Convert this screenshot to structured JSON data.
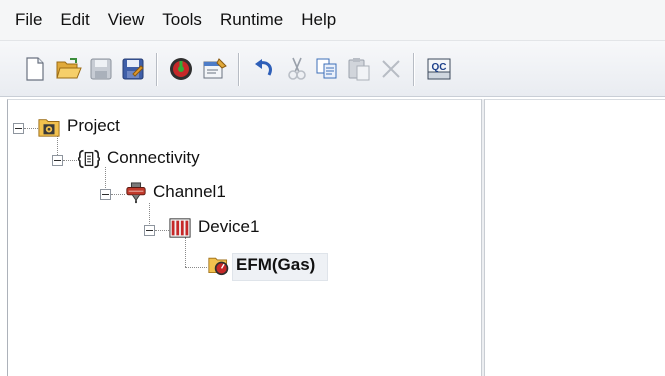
{
  "menu": [
    "File",
    "Edit",
    "View",
    "Tools",
    "Runtime",
    "Help"
  ],
  "toolbar": {
    "buttons": [
      {
        "name": "new-project-icon"
      },
      {
        "name": "open-folder-icon"
      },
      {
        "name": "save-icon"
      },
      {
        "name": "save-as-icon"
      },
      {
        "name": "connect-runtime-icon"
      },
      {
        "name": "properties-icon"
      },
      {
        "name": "undo-icon"
      },
      {
        "name": "cut-icon"
      },
      {
        "name": "copy-icon"
      },
      {
        "name": "paste-icon"
      },
      {
        "name": "delete-icon"
      },
      {
        "name": "quick-client-icon"
      }
    ],
    "qc_label": "QC"
  },
  "tree": {
    "project": "Project",
    "connectivity": "Connectivity",
    "channel": "Channel1",
    "device": "Device1",
    "efm": "EFM(Gas)"
  },
  "colors": {
    "folder": "#f2c14e",
    "channel": "#c0392b",
    "device_red": "#c62828",
    "toolbar_bg": "#eef0f4"
  }
}
